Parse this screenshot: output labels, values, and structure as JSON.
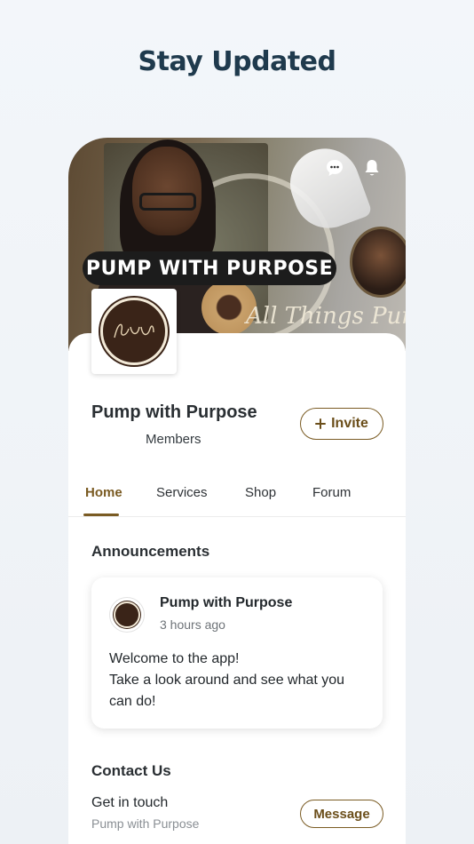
{
  "headline": "Stay Updated",
  "cover": {
    "banner_text": "PUMP WITH PURPOSE",
    "script_text": "All Things Pump"
  },
  "group": {
    "title": "Pump with Purpose",
    "members_label": "Members",
    "invite_label": "Invite"
  },
  "tabs": [
    {
      "label": "Home",
      "active": true
    },
    {
      "label": "Services",
      "active": false
    },
    {
      "label": "Shop",
      "active": false
    },
    {
      "label": "Forum",
      "active": false
    }
  ],
  "announcements": {
    "title": "Announcements",
    "post": {
      "author": "Pump with Purpose",
      "time": "3 hours ago",
      "body_line1": "Welcome to the app!",
      "body_line2": "Take a look around and see what you",
      "body_line3": "can do!"
    }
  },
  "contact": {
    "title": "Contact Us",
    "line1": "Get in touch",
    "line2": "Pump with Purpose",
    "button_label": "Message"
  },
  "icons": {
    "more": "more-dots-icon",
    "notifications": "bell-icon",
    "invite": "plus-icon"
  },
  "colors": {
    "accent": "#7a5b23",
    "headline": "#1f3a4d"
  }
}
